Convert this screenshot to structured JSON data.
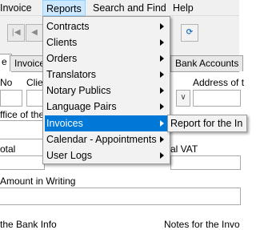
{
  "menubar": {
    "invoice": "Invoice",
    "reports": "Reports",
    "search_and_find": "Search and Find",
    "help": "Help"
  },
  "toolbar": {
    "first_icon": "first-record-icon",
    "prev_icon": "previous-record-icon",
    "refresh_icon": "refresh-icon"
  },
  "tabs": {
    "tab_e": "e",
    "invoice": "Invoice",
    "bank_accounts": "Bank Accounts"
  },
  "form": {
    "no_label": "No",
    "client_label": "Clie",
    "address_label": "Address of t",
    "office_label": "ffice of the",
    "total_label": "otal",
    "total_vat_label": "al VAT",
    "amount_in_writing_label": "Amount in Writing",
    "bottom_left_label": "the Bank Info",
    "bottom_right_label": "Notes for the Invo"
  },
  "reports_menu": {
    "items": [
      {
        "label": "Contracts"
      },
      {
        "label": "Clients"
      },
      {
        "label": "Orders"
      },
      {
        "label": "Translators"
      },
      {
        "label": "Notary Publics"
      },
      {
        "label": "Language Pairs"
      },
      {
        "label": "Invoices"
      },
      {
        "label": "Calendar - Appointments"
      },
      {
        "label": "User Logs"
      }
    ],
    "highlighted": "Invoices"
  },
  "invoices_submenu": {
    "item": "Report for the In"
  },
  "colors": {
    "highlight": "#0078d7",
    "menu_active_bg": "#cce8ff",
    "toolbar_bg": "#f0f0f0"
  }
}
